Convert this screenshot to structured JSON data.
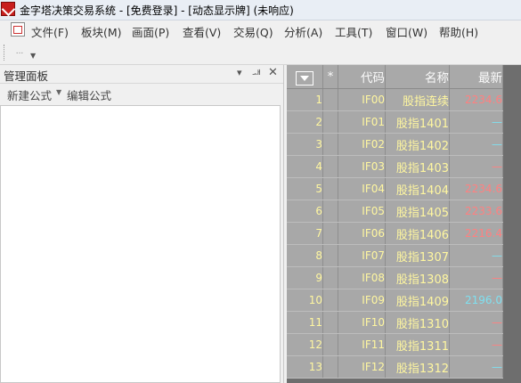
{
  "window": {
    "title": "金字塔决策交易系统 - [免费登录] - [动态显示牌] (未响应)"
  },
  "menu": {
    "items": [
      "文件(F)",
      "板块(M)",
      "画面(P)",
      "查看(V)",
      "交易(Q)",
      "分析(A)",
      "工具(T)",
      "窗口(W)",
      "帮助(H)"
    ]
  },
  "toolbar": {
    "button_text": "..."
  },
  "left_panel": {
    "title": "管理面板",
    "tab_new": "新建公式",
    "tab_edit": "编辑公式"
  },
  "quote_table": {
    "headers": {
      "star": "*",
      "code": "代码",
      "name": "名称",
      "last": "最新"
    },
    "rows": [
      {
        "num": "1",
        "code": "IF00",
        "name": "股指连续",
        "last": "2234.6",
        "dir": "up"
      },
      {
        "num": "2",
        "code": "IF01",
        "name": "股指1401",
        "last": "—",
        "dir": "down"
      },
      {
        "num": "3",
        "code": "IF02",
        "name": "股指1402",
        "last": "—",
        "dir": "down"
      },
      {
        "num": "4",
        "code": "IF03",
        "name": "股指1403",
        "last": "—",
        "dir": "up"
      },
      {
        "num": "5",
        "code": "IF04",
        "name": "股指1404",
        "last": "2234.6",
        "dir": "up"
      },
      {
        "num": "6",
        "code": "IF05",
        "name": "股指1405",
        "last": "2233.6",
        "dir": "up"
      },
      {
        "num": "7",
        "code": "IF06",
        "name": "股指1406",
        "last": "2216.4",
        "dir": "up"
      },
      {
        "num": "8",
        "code": "IF07",
        "name": "股指1307",
        "last": "—",
        "dir": "down"
      },
      {
        "num": "9",
        "code": "IF08",
        "name": "股指1308",
        "last": "—",
        "dir": "up"
      },
      {
        "num": "10",
        "code": "IF09",
        "name": "股指1409",
        "last": "2196.0",
        "dir": "down"
      },
      {
        "num": "11",
        "code": "IF10",
        "name": "股指1310",
        "last": "—",
        "dir": "up"
      },
      {
        "num": "12",
        "code": "IF11",
        "name": "股指1311",
        "last": "—",
        "dir": "up"
      },
      {
        "num": "13",
        "code": "IF12",
        "name": "股指1312",
        "last": "—",
        "dir": "down"
      }
    ]
  },
  "colors": {
    "up": "#ff8080",
    "down": "#7fe0f0",
    "code_text": "#fff7a0",
    "grid_bg": "#a8a8a8"
  }
}
